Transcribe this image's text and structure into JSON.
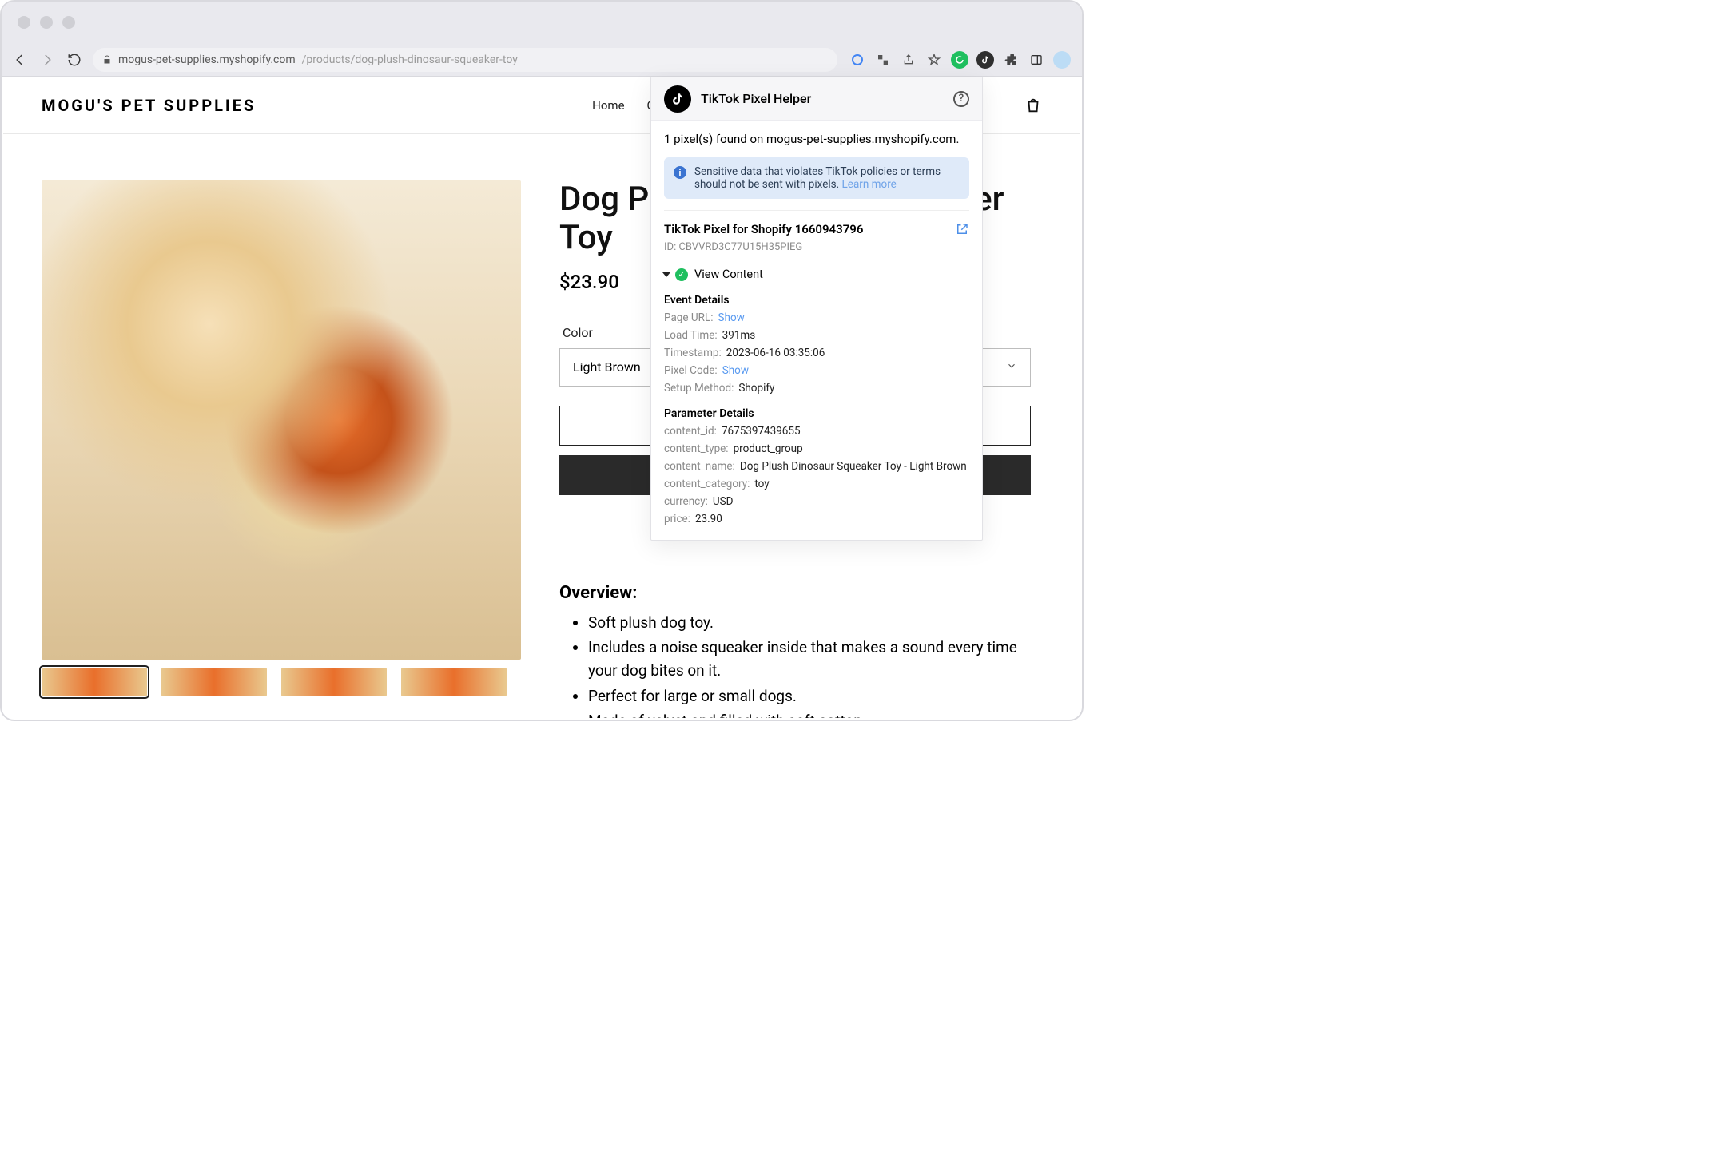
{
  "browser": {
    "url_host": "mogus-pet-supplies.myshopify.com",
    "url_path": "/products/dog-plush-dinosaur-squeaker-toy"
  },
  "site": {
    "brand": "MOGU'S PET SUPPLIES",
    "nav": {
      "home": "Home",
      "catalog": "Catalog"
    }
  },
  "product": {
    "title": "Dog Plush Dinosaur Squeaker Toy",
    "title_visible": "Dog Pl\nToy",
    "price": "$23.90",
    "color_label": "Color",
    "color_value": "Light Brown",
    "overview_heading": "Overview:",
    "overview": [
      "Soft plush dog toy.",
      "Includes a noise squeaker inside that makes a sound every time your dog bites on it.",
      "Perfect for large or small dogs.",
      "Made of velvet and filled with soft cotton."
    ]
  },
  "panel": {
    "title": "TikTok Pixel Helper",
    "found_text": "1 pixel(s) found on mogus-pet-supplies.myshopify.com.",
    "banner_text": "Sensitive data that violates TikTok policies or terms should not be sent with pixels.",
    "banner_link": "Learn more",
    "pixel_name": "TikTok Pixel for Shopify 1660943796",
    "pixel_id_label": "ID:",
    "pixel_id": "CBVVRD3C77U15H35PIEG",
    "event_name": "View Content",
    "event_details_heading": "Event Details",
    "event_details": {
      "page_url_label": "Page URL:",
      "page_url_value": "Show",
      "load_time_label": "Load Time:",
      "load_time_value": "391ms",
      "timestamp_label": "Timestamp:",
      "timestamp_value": "2023-06-16 03:35:06",
      "pixel_code_label": "Pixel Code:",
      "pixel_code_value": "Show",
      "setup_label": "Setup Method:",
      "setup_value": "Shopify"
    },
    "param_heading": "Parameter Details",
    "params": {
      "content_id_label": "content_id:",
      "content_id_value": "7675397439655",
      "content_type_label": "content_type:",
      "content_type_value": "product_group",
      "content_name_label": "content_name:",
      "content_name_value": "Dog Plush Dinosaur Squeaker Toy - Light Brown",
      "content_category_label": "content_category:",
      "content_category_value": "toy",
      "currency_label": "currency:",
      "currency_value": "USD",
      "price_label": "price:",
      "price_value": "23.90"
    }
  }
}
